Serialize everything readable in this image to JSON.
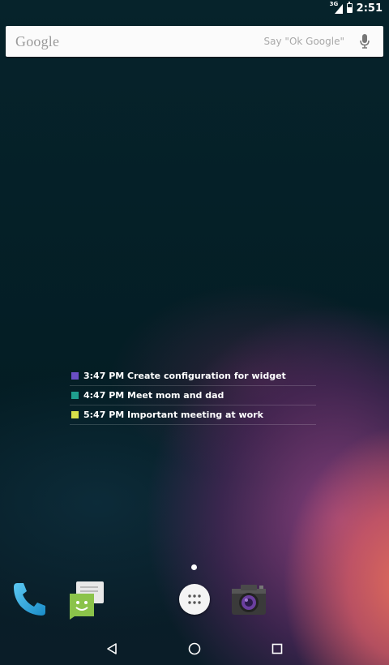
{
  "status_bar": {
    "network": "3G",
    "time": "2:51"
  },
  "search_bar": {
    "logo": "Google",
    "hint": "Say \"Ok Google\"",
    "icon": "mic-icon"
  },
  "calendar_widget": {
    "events": [
      {
        "time": "3:47 PM",
        "title": "Create configuration for widget",
        "label": "3:47 PM Create configuration for widget",
        "color": "#6a4fc4"
      },
      {
        "time": "4:47 PM",
        "title": "Meet mom and dad",
        "label": "4:47 PM Meet mom and dad",
        "color": "#1f9e8e"
      },
      {
        "time": "5:47 PM",
        "title": "Important meeting at work",
        "label": "5:47 PM Important meeting at work",
        "color": "#d7e04a"
      }
    ]
  },
  "dock": {
    "apps": [
      {
        "name": "Phone",
        "icon": "phone-icon"
      },
      {
        "name": "Messaging",
        "icon": "messaging-icon"
      },
      {
        "name": "Apps",
        "icon": "app-drawer-icon"
      },
      {
        "name": "Camera",
        "icon": "camera-icon"
      }
    ]
  },
  "nav_bar": {
    "buttons": [
      "back",
      "home",
      "recents"
    ]
  }
}
